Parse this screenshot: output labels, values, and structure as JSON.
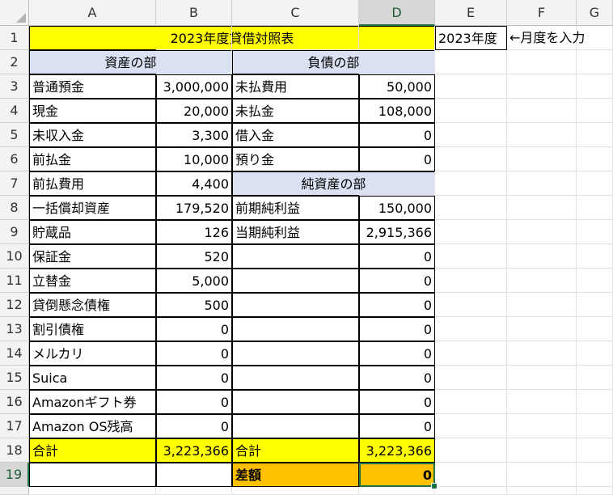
{
  "columns": [
    "A",
    "B",
    "C",
    "D",
    "E",
    "F",
    "G"
  ],
  "rows": [
    "1",
    "2",
    "3",
    "4",
    "5",
    "6",
    "7",
    "8",
    "9",
    "10",
    "11",
    "12",
    "13",
    "14",
    "15",
    "16",
    "17",
    "18",
    "19"
  ],
  "title": "2023年度貸借対照表",
  "year_cell": "2023年度",
  "year_note": "←月度を入力",
  "assets_header": "資産の部",
  "liabilities_header": "負債の部",
  "net_assets_header": "純資産の部",
  "assets": [
    {
      "name": "普通預金",
      "value": "3,000,000"
    },
    {
      "name": "現金",
      "value": "20,000"
    },
    {
      "name": "未収入金",
      "value": "3,300"
    },
    {
      "name": "前払金",
      "value": "10,000"
    },
    {
      "name": "前払費用",
      "value": "4,400"
    },
    {
      "name": "一括償却資産",
      "value": "179,520"
    },
    {
      "name": "貯蔵品",
      "value": "126"
    },
    {
      "name": "保証金",
      "value": "520"
    },
    {
      "name": "立替金",
      "value": "5,000"
    },
    {
      "name": "貸倒懸念債権",
      "value": "500"
    },
    {
      "name": "割引債権",
      "value": "0"
    },
    {
      "name": "メルカリ",
      "value": "0"
    },
    {
      "name": "Suica",
      "value": "0"
    },
    {
      "name": "Amazonギフト券",
      "value": "0"
    },
    {
      "name": "Amazon OS残高",
      "value": "0"
    }
  ],
  "liabilities": [
    {
      "name": "未払費用",
      "value": "50,000"
    },
    {
      "name": "未払金",
      "value": "108,000"
    },
    {
      "name": "借入金",
      "value": "0"
    },
    {
      "name": "預り金",
      "value": "0"
    }
  ],
  "net_assets": [
    {
      "name": "前期純利益",
      "value": "150,000"
    },
    {
      "name": "当期純利益",
      "value": "2,915,366"
    },
    {
      "name": "",
      "value": "0"
    },
    {
      "name": "",
      "value": "0"
    },
    {
      "name": "",
      "value": "0"
    },
    {
      "name": "",
      "value": "0"
    },
    {
      "name": "",
      "value": "0"
    },
    {
      "name": "",
      "value": "0"
    },
    {
      "name": "",
      "value": "0"
    },
    {
      "name": "",
      "value": "0"
    }
  ],
  "total_label_left": "合計",
  "total_left": "3,223,366",
  "total_label_right": "合計",
  "total_right": "3,223,366",
  "diff_label": "差額",
  "diff_value": "0",
  "colors": {
    "title_fill": "#ffff00",
    "section_fill": "#d9e1f2",
    "diff_fill": "#ffc000",
    "selection": "#217346"
  }
}
